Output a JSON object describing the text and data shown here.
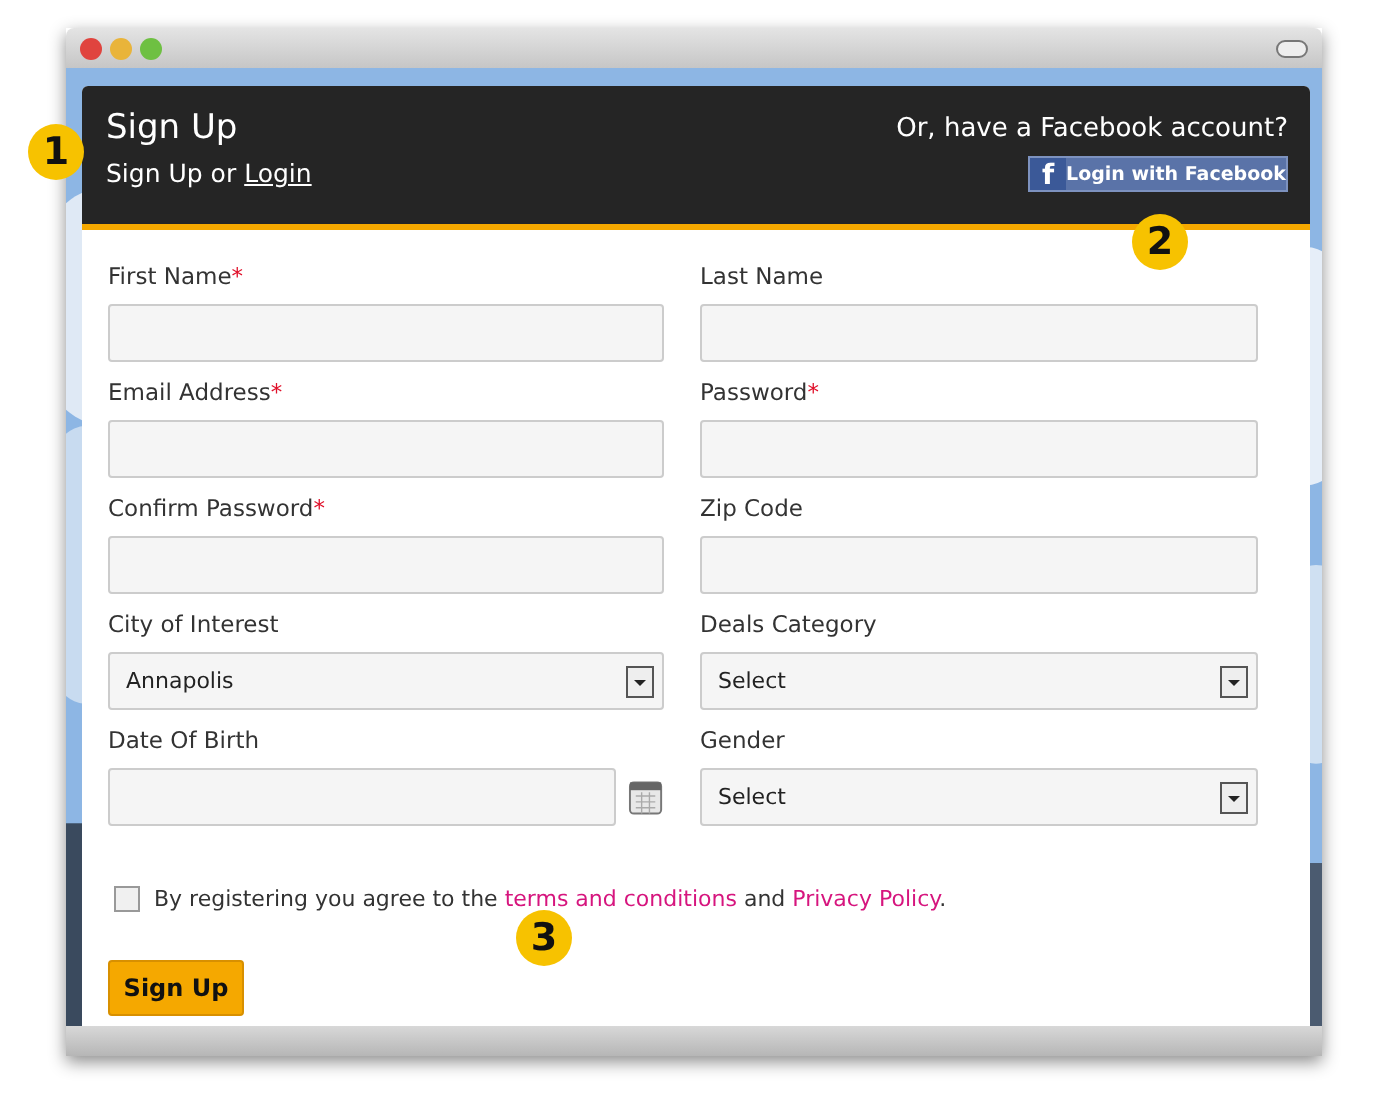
{
  "header": {
    "title": "Sign Up",
    "subtitle_prefix": "Sign Up or",
    "login_link": "Login",
    "facebook_prompt": "Or, have a Facebook account?",
    "facebook_button": {
      "icon_letter": "f",
      "label": "Login with Facebook"
    }
  },
  "fields": [
    {
      "kind": "text",
      "label": "First Name",
      "required_mark": "*"
    },
    {
      "kind": "text",
      "label": "Last Name"
    },
    {
      "kind": "text",
      "label": "Email Address",
      "required_mark": "*"
    },
    {
      "kind": "text",
      "label": "Password",
      "required_mark": "*"
    },
    {
      "kind": "text",
      "label": "Confirm Password",
      "required_mark": "*"
    },
    {
      "kind": "text",
      "label": "Zip Code"
    },
    {
      "kind": "select",
      "label": "City of Interest",
      "value": "Annapolis"
    },
    {
      "kind": "select",
      "label": "Deals Category",
      "value": "Select"
    },
    {
      "kind": "date",
      "label": "Date Of Birth"
    },
    {
      "kind": "select",
      "label": "Gender",
      "value": "Select"
    }
  ],
  "agreement": {
    "checked": false,
    "text_before": "By registering you agree to the",
    "terms_link": "terms and conditions",
    "text_middle": "and",
    "privacy_link": "Privacy Policy",
    "text_after": "."
  },
  "submit_button": "Sign Up",
  "callouts": [
    {
      "number": "1"
    },
    {
      "number": "2"
    },
    {
      "number": "3"
    }
  ]
}
